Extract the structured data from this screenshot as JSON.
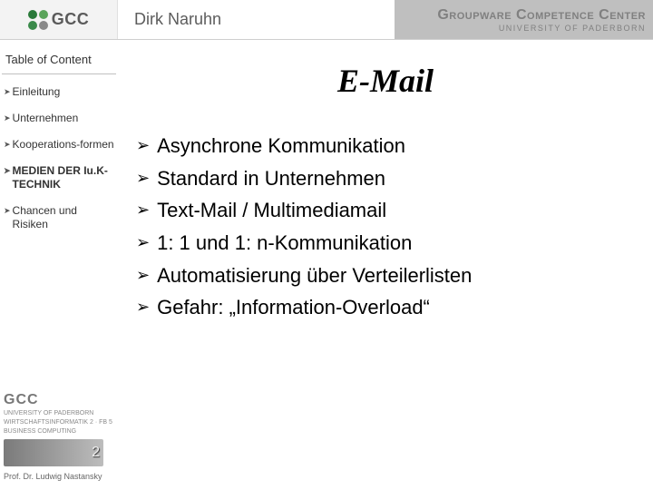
{
  "header": {
    "logo_text": "GCC",
    "presenter": "Dirk Naruhn",
    "org_main": "Groupware Competence Center",
    "org_sub": "UNIVERSITY OF PADERBORN"
  },
  "sidebar": {
    "toc_title": "Table of Content",
    "items": [
      {
        "label": "Einleitung",
        "active": false
      },
      {
        "label": "Unternehmen",
        "active": false
      },
      {
        "label": "Kooperations-formen",
        "active": false
      },
      {
        "label": "MEDIEN DER Iu.K-TECHNIK",
        "active": true
      },
      {
        "label": "Chancen und Risiken",
        "active": false
      }
    ],
    "footer": {
      "gcc": "GCC",
      "uni_line1": "UNIVERSITY OF PADERBORN",
      "uni_line2": "WIRTSCHAFTSINFORMATIK 2 · FB 5",
      "bc_label": "BUSINESS COMPUTING",
      "bc_num": "2",
      "prof": "Prof. Dr. Ludwig Nastansky"
    }
  },
  "main": {
    "title": "E-Mail",
    "bullets": [
      "Asynchrone Kommunikation",
      "Standard in Unternehmen",
      "Text-Mail / Multimediamail",
      "1: 1 und 1: n-Kommunikation",
      "Automatisierung über Verteilerlisten",
      "Gefahr: „Information-Overload“"
    ]
  }
}
